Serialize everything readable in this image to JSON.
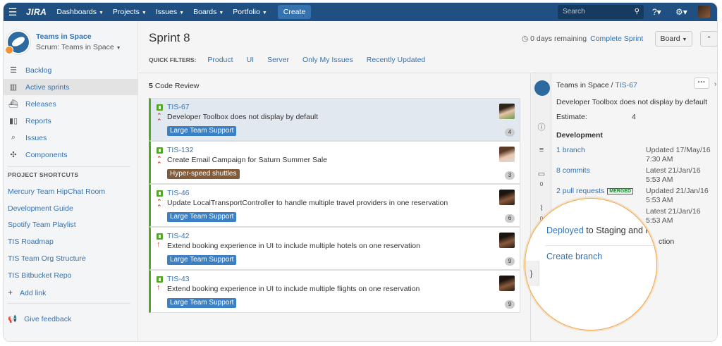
{
  "topbar": {
    "logo": "JIRA",
    "nav": [
      "Dashboards",
      "Projects",
      "Issues",
      "Boards",
      "Portfolio"
    ],
    "create_label": "Create",
    "search_placeholder": "Search"
  },
  "sidebar": {
    "project_name": "Teams in Space",
    "board_name": "Scrum: Teams in Space",
    "nav_items": [
      {
        "label": "Backlog",
        "icon": "backlog-icon"
      },
      {
        "label": "Active sprints",
        "icon": "board-icon"
      },
      {
        "label": "Releases",
        "icon": "ship-icon"
      },
      {
        "label": "Reports",
        "icon": "chart-icon"
      },
      {
        "label": "Issues",
        "icon": "issues-icon"
      },
      {
        "label": "Components",
        "icon": "puzzle-icon"
      }
    ],
    "shortcuts_heading": "PROJECT SHORTCUTS",
    "shortcuts": [
      "Mercury Team HipChat Room",
      "Development Guide",
      "Spotify Team Playlist",
      "TIS Roadmap",
      "TIS Team Org Structure",
      "TIS Bitbucket Repo"
    ],
    "add_link": "Add link",
    "feedback": "Give feedback"
  },
  "board": {
    "title": "Sprint 8",
    "quick_filters_label": "QUICK FILTERS:",
    "quick_filters": [
      "Product",
      "UI",
      "Server",
      "Only My Issues",
      "Recently Updated"
    ],
    "remaining": "0 days remaining",
    "complete_sprint": "Complete Sprint",
    "board_button": "Board"
  },
  "column": {
    "count": "5",
    "name": "Code Review",
    "cards": [
      {
        "key": "TIS-67",
        "summary": "Developer Toolbox does not display by default",
        "epic": "Large Team Support",
        "epic_color": "#3b7fc4",
        "estimate": "4",
        "priority": "highest"
      },
      {
        "key": "TIS-132",
        "summary": "Create Email Campaign for Saturn Summer Sale",
        "epic": "Hyper-speed shuttles",
        "epic_color": "#815b3a",
        "estimate": "3",
        "priority": "highest"
      },
      {
        "key": "TIS-46",
        "summary": "Update LocalTransportController to handle multiple travel providers in one reservation",
        "epic": "Large Team Support",
        "epic_color": "#3b7fc4",
        "estimate": "6",
        "priority": "highest"
      },
      {
        "key": "TIS-42",
        "summary": "Extend booking experience in UI to include multiple hotels on one reservation",
        "epic": "Large Team Support",
        "epic_color": "#3b7fc4",
        "estimate": "9",
        "priority": "high"
      },
      {
        "key": "TIS-43",
        "summary": "Extend booking experience in UI to include multiple flights on one reservation",
        "epic": "Large Team Support",
        "epic_color": "#3b7fc4",
        "estimate": "9",
        "priority": "high"
      }
    ]
  },
  "detail": {
    "project": "Teams in Space",
    "key": "TIS-67",
    "summary": "Developer Toolbox does not display by default",
    "estimate_label": "Estimate:",
    "estimate_value": "4",
    "development_heading": "Development",
    "branch": "1 branch",
    "branch_updated": "Updated 17/May/16 7:30 AM",
    "commits": "8 commits",
    "commits_latest": "Latest 21/Jan/16 5:53 AM",
    "pull_requests": "2 pull requests",
    "merged_badge": "MERGED",
    "pr_updated": "Updated 21/Jan/16 5:53 AM",
    "fourth_latest": "Latest 21/Jan/16 5:53 AM",
    "side_counts": [
      "0",
      "0"
    ],
    "deployed_link": "Deployed",
    "deployed_rest": " to Staging and P",
    "behind_text": "ction",
    "create_branch": "Create branch"
  }
}
